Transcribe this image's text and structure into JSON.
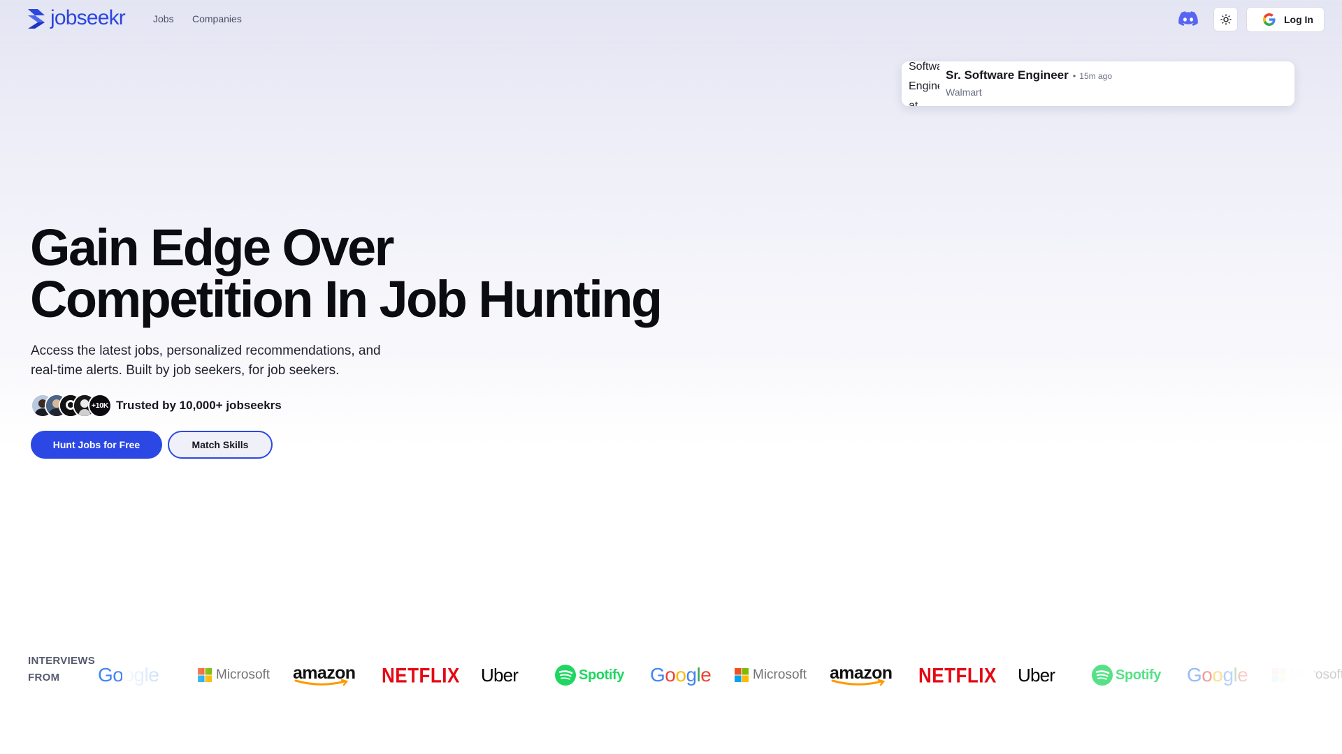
{
  "nav": {
    "brand": "jobseekr",
    "links": [
      "Jobs",
      "Companies"
    ],
    "login_label": "Log In",
    "icons": [
      "discord-icon",
      "sun-icon",
      "google-icon"
    ]
  },
  "notification": {
    "behind_text": "Software Engineer at",
    "role": "Sr. Software Engineer",
    "separator": "•",
    "time": "15m ago",
    "company": "Walmart"
  },
  "hero": {
    "title_line1": "Gain Edge Over",
    "title_line2": "Competition In Job Hunting",
    "subtitle_line1": "Access the latest jobs, personalized recommendations, and",
    "subtitle_line2": "real-time alerts. Built by job seekers, for job seekers.",
    "avatars_more": "+10K",
    "trust_text": "Trusted by 10,000+ jobseekrs",
    "primary_cta": "Hunt Jobs for Free",
    "secondary_cta": "Match Skills"
  },
  "logos": {
    "heading_line1": "INTERVIEWS",
    "heading_line2": "FROM",
    "brands": [
      "Google",
      "Microsoft",
      "amazon",
      "NETFLIX",
      "Uber",
      "Spotify",
      "Google",
      "Microsoft",
      "amazon",
      "NETFLIX",
      "Uber",
      "Spotify",
      "Google",
      "Microsoft"
    ]
  },
  "colors": {
    "accent": "#2c48e4",
    "discord": "#5865f2",
    "netflix": "#e50914",
    "spotify": "#1ed760"
  }
}
